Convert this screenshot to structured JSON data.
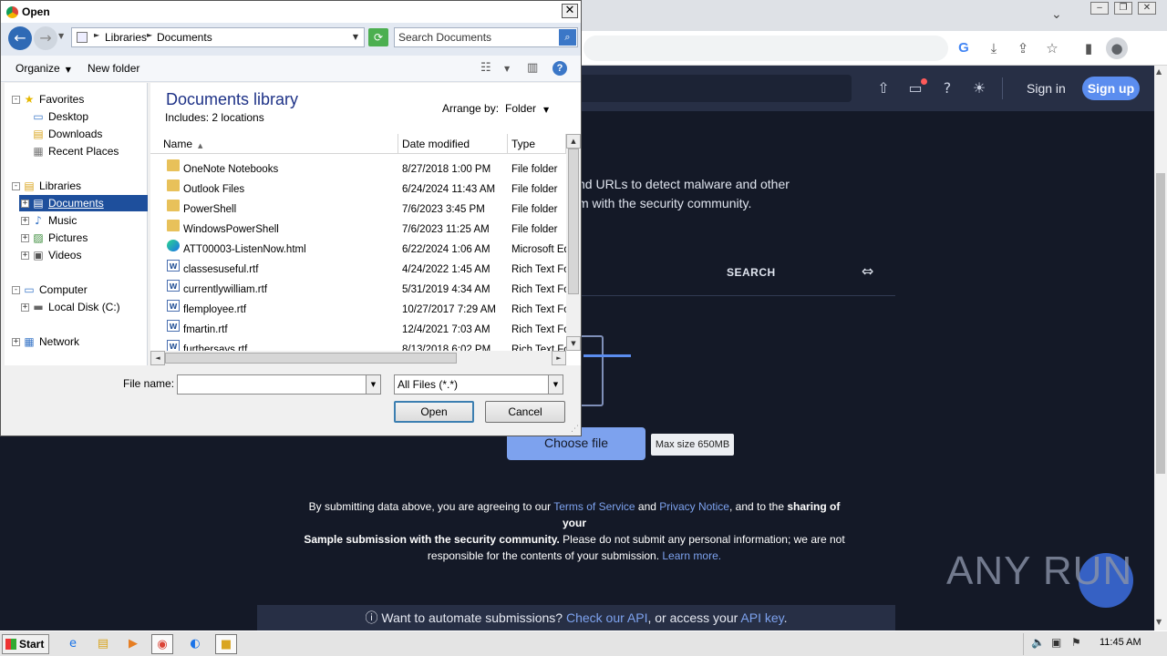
{
  "browser": {
    "toolbar_icons": [
      "google-g-icon",
      "download-icon",
      "share-icon",
      "bookmark-star-icon",
      "side-panel-icon",
      "profile-icon"
    ]
  },
  "site": {
    "header": {
      "sign_in": "Sign in",
      "sign_up": "Sign up"
    },
    "intro_line1": "nd URLs to detect malware and other",
    "intro_line2": "m with the security community.",
    "tab_search": "SEARCH",
    "choose_file": "Choose file",
    "max_size": "Max size 650MB",
    "terms": {
      "t1": "By submitting data above, you are agreeing to our ",
      "tos": "Terms of Service",
      "t2": " and ",
      "privacy": "Privacy Notice",
      "t3": ", and to the ",
      "bold1": "sharing of your",
      "bold2": "Sample submission with the security community.",
      "t4": " Please do not submit any personal information; we are not responsible for the contents of your submission. ",
      "learn": "Learn more."
    },
    "api_bar": {
      "icon": "ⓘ",
      "t1": "Want to automate submissions? ",
      "api_link": "Check our API",
      "t2": ", or access your ",
      "key_link": "API key",
      "t3": "."
    },
    "watermark": "ANY RUN"
  },
  "taskbar": {
    "start": "Start",
    "clock": "11:45 AM"
  },
  "dialog": {
    "title": "Open",
    "breadcrumb": [
      "Libraries",
      "Documents"
    ],
    "search_placeholder": "Search Documents",
    "organize": "Organize",
    "new_folder": "New folder",
    "nav": {
      "favorites": "Favorites",
      "desktop": "Desktop",
      "downloads": "Downloads",
      "recent": "Recent Places",
      "libraries": "Libraries",
      "documents": "Documents",
      "music": "Music",
      "pictures": "Pictures",
      "videos": "Videos",
      "computer": "Computer",
      "local_disk": "Local Disk (C:)",
      "network": "Network"
    },
    "library_title": "Documents library",
    "library_sub": "Includes:  2 locations",
    "arrange_label": "Arrange by:",
    "arrange_value": "Folder",
    "columns": {
      "name": "Name",
      "date": "Date modified",
      "type": "Type"
    },
    "files": [
      {
        "name": "OneNote Notebooks",
        "date": "8/27/2018 1:00 PM",
        "type": "File folder",
        "icon": "folder"
      },
      {
        "name": "Outlook Files",
        "date": "6/24/2024 11:43 AM",
        "type": "File folder",
        "icon": "folder"
      },
      {
        "name": "PowerShell",
        "date": "7/6/2023 3:45 PM",
        "type": "File folder",
        "icon": "folder"
      },
      {
        "name": "WindowsPowerShell",
        "date": "7/6/2023 11:25 AM",
        "type": "File folder",
        "icon": "folder"
      },
      {
        "name": "ATT00003-ListenNow.html",
        "date": "6/22/2024 1:06 AM",
        "type": "Microsoft Ed",
        "icon": "edge"
      },
      {
        "name": "classesuseful.rtf",
        "date": "4/24/2022 1:45 AM",
        "type": "Rich Text Fo",
        "icon": "doc"
      },
      {
        "name": "currentlywilliam.rtf",
        "date": "5/31/2019 4:34 AM",
        "type": "Rich Text Fo",
        "icon": "doc"
      },
      {
        "name": "flemployee.rtf",
        "date": "10/27/2017 7:29 AM",
        "type": "Rich Text Fo",
        "icon": "doc"
      },
      {
        "name": "fmartin.rtf",
        "date": "12/4/2021 7:03 AM",
        "type": "Rich Text Fo",
        "icon": "doc"
      },
      {
        "name": "furthersays.rtf",
        "date": "8/13/2018 6:02 PM",
        "type": "Rich Text Fo",
        "icon": "doc"
      }
    ],
    "file_name_label": "File name:",
    "file_name_value": "",
    "filter": "All Files (*.*)",
    "open_button": "Open",
    "cancel_button": "Cancel"
  }
}
